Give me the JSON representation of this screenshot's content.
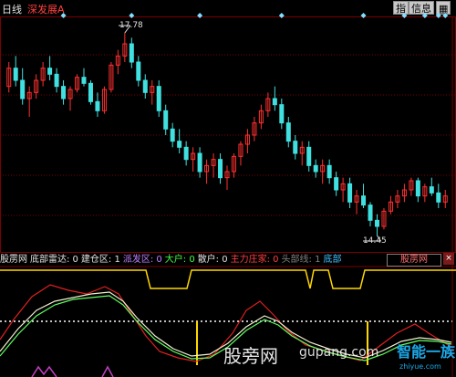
{
  "toolbar": {
    "period": "日线",
    "stock_name": "深发展A",
    "btn_indicator": "指",
    "btn_info": "信息",
    "btn_grid": "▦"
  },
  "price_chart": {
    "high_label": "17.78",
    "low_label": "14.45",
    "candles": [
      [
        16.9,
        17.3,
        16.8,
        17.2
      ],
      [
        17.2,
        17.4,
        16.9,
        17.0
      ],
      [
        17.0,
        17.2,
        16.6,
        16.7
      ],
      [
        16.7,
        16.9,
        16.4,
        16.8
      ],
      [
        16.8,
        17.1,
        16.7,
        17.0
      ],
      [
        17.0,
        17.3,
        16.9,
        17.2
      ],
      [
        17.2,
        17.4,
        17.0,
        17.1
      ],
      [
        17.1,
        17.2,
        16.8,
        16.9
      ],
      [
        16.9,
        17.0,
        16.6,
        16.7
      ],
      [
        16.7,
        16.9,
        16.5,
        16.85
      ],
      [
        16.85,
        17.1,
        16.8,
        17.05
      ],
      [
        17.05,
        17.2,
        16.9,
        16.95
      ],
      [
        16.95,
        17.0,
        16.6,
        16.65
      ],
      [
        16.65,
        16.8,
        16.4,
        16.5
      ],
      [
        16.5,
        16.9,
        16.45,
        16.85
      ],
      [
        16.85,
        17.3,
        16.8,
        17.25
      ],
      [
        17.25,
        17.5,
        17.1,
        17.4
      ],
      [
        17.4,
        17.78,
        17.3,
        17.6
      ],
      [
        17.6,
        17.7,
        17.2,
        17.3
      ],
      [
        17.3,
        17.4,
        16.9,
        17.0
      ],
      [
        17.0,
        17.1,
        16.7,
        16.8
      ],
      [
        16.8,
        17.0,
        16.6,
        16.9
      ],
      [
        16.9,
        17.0,
        16.4,
        16.5
      ],
      [
        16.5,
        16.6,
        16.1,
        16.2
      ],
      [
        16.2,
        16.3,
        15.9,
        16.0
      ],
      [
        16.0,
        16.2,
        15.8,
        15.9
      ],
      [
        15.9,
        16.0,
        15.6,
        15.7
      ],
      [
        15.7,
        15.9,
        15.5,
        15.8
      ],
      [
        15.8,
        15.9,
        15.4,
        15.5
      ],
      [
        15.5,
        15.7,
        15.3,
        15.6
      ],
      [
        15.6,
        15.8,
        15.4,
        15.7
      ],
      [
        15.7,
        15.8,
        15.3,
        15.4
      ],
      [
        15.4,
        15.6,
        15.2,
        15.5
      ],
      [
        15.5,
        15.8,
        15.4,
        15.75
      ],
      [
        15.75,
        16.0,
        15.6,
        15.95
      ],
      [
        15.95,
        16.2,
        15.8,
        16.1
      ],
      [
        16.1,
        16.4,
        16.0,
        16.3
      ],
      [
        16.3,
        16.6,
        16.2,
        16.5
      ],
      [
        16.5,
        16.8,
        16.4,
        16.7
      ],
      [
        16.7,
        16.9,
        16.5,
        16.6
      ],
      [
        16.6,
        16.7,
        16.2,
        16.3
      ],
      [
        16.3,
        16.4,
        15.9,
        16.0
      ],
      [
        16.0,
        16.1,
        15.7,
        15.8
      ],
      [
        15.8,
        16.0,
        15.6,
        15.9
      ],
      [
        15.9,
        16.0,
        15.5,
        15.6
      ],
      [
        15.6,
        15.7,
        15.4,
        15.5
      ],
      [
        15.5,
        15.7,
        15.3,
        15.6
      ],
      [
        15.6,
        15.7,
        15.3,
        15.4
      ],
      [
        15.4,
        15.5,
        15.1,
        15.2
      ],
      [
        15.2,
        15.4,
        15.0,
        15.3
      ],
      [
        15.3,
        15.4,
        14.9,
        15.0
      ],
      [
        15.0,
        15.2,
        14.8,
        15.1
      ],
      [
        15.1,
        15.3,
        14.9,
        14.95
      ],
      [
        14.95,
        15.0,
        14.6,
        14.7
      ],
      [
        14.7,
        14.8,
        14.45,
        14.6
      ],
      [
        14.6,
        14.9,
        14.55,
        14.85
      ],
      [
        14.85,
        15.1,
        14.8,
        15.0
      ],
      [
        15.0,
        15.2,
        14.9,
        15.1
      ],
      [
        15.1,
        15.3,
        15.0,
        15.2
      ],
      [
        15.2,
        15.4,
        15.1,
        15.35
      ],
      [
        15.35,
        15.4,
        15.0,
        15.1
      ],
      [
        15.1,
        15.3,
        15.0,
        15.25
      ],
      [
        15.25,
        15.4,
        15.1,
        15.15
      ],
      [
        15.15,
        15.3,
        14.9,
        15.0
      ],
      [
        15.0,
        15.2,
        14.9,
        15.1
      ]
    ],
    "marker_indices": [
      8,
      18,
      28,
      40,
      52,
      58,
      61,
      63,
      64
    ]
  },
  "indicator_bar": {
    "name": "股雳网",
    "items": [
      {
        "text": "底部雷达: 0",
        "color": "#e0e0e0"
      },
      {
        "text": "建仓区: 1",
        "color": "#e0e0e0"
      },
      {
        "text": "派发区: 0",
        "color": "#c080ff"
      },
      {
        "text": "大户: 0",
        "color": "#40ff40"
      },
      {
        "text": "散户: 0",
        "color": "#e0e0e0"
      },
      {
        "text": "主力庄家: 0",
        "color": "#ff4040"
      },
      {
        "text": "头部线: 1",
        "color": "#808080"
      },
      {
        "text": "底部",
        "color": "#40c0ff"
      }
    ],
    "box_label": "股雳网",
    "close_glyph": "×"
  },
  "watermark": {
    "brand": "股旁网",
    "url": "gupang.com",
    "logo_text": "智能一族",
    "logo_url": "zhiyue.com"
  },
  "colors": {
    "up": "#ff3030",
    "down": "#40e0e0",
    "grid": "#7a0000",
    "yellow": "#ffd700",
    "white": "#ffffff",
    "magenta": "#c040c0"
  }
}
